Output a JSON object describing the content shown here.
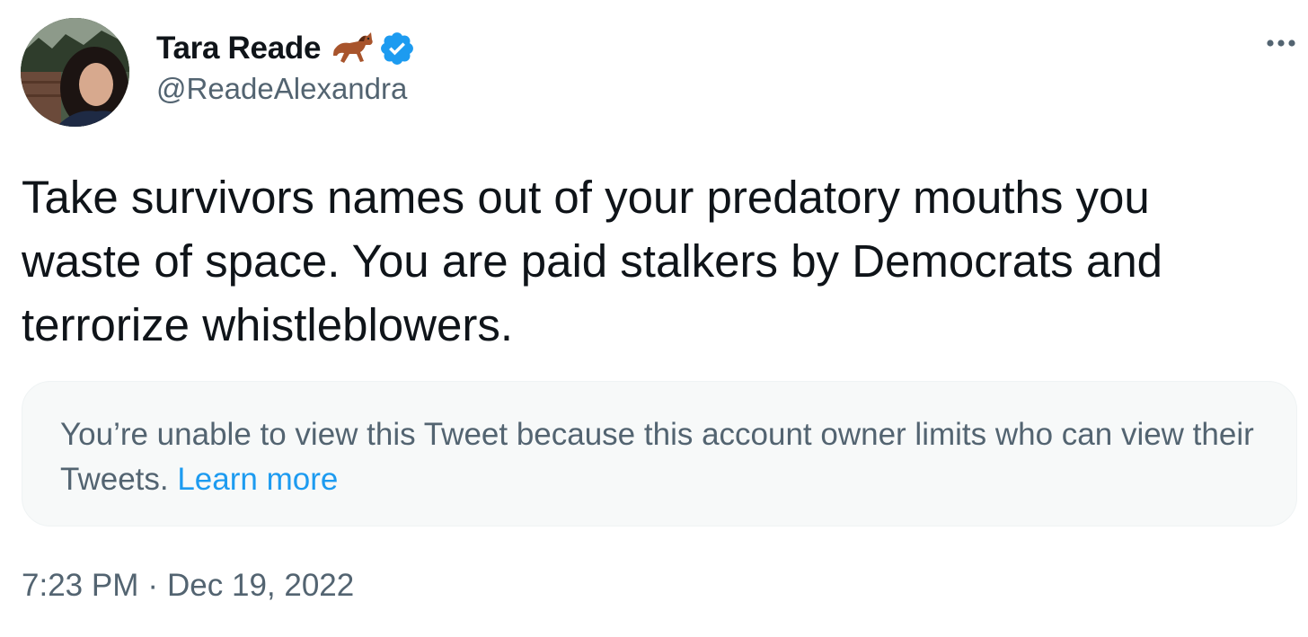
{
  "tweet": {
    "author": {
      "display_name": "Tara Reade",
      "handle": "@ReadeAlexandra",
      "name_emoji": "horse-icon",
      "verified": true,
      "verified_color": "#1d9bf0"
    },
    "text": "Take survivors names out of your predatory mouths you waste of space. You are paid stalkers by Democrats and terrorize whistleblowers.",
    "quoted_notice": {
      "message": "You’re unable to view this Tweet because this account owner limits who can view their Tweets.",
      "link_label": "Learn more"
    },
    "time": "7:23 PM",
    "separator": "·",
    "date": "Dec 19, 2022",
    "more_icon": "more-horizontal-icon"
  },
  "colors": {
    "primary_text": "#0f1419",
    "secondary_text": "#536471",
    "link": "#1d9bf0",
    "notice_background": "#f7f9f9"
  }
}
